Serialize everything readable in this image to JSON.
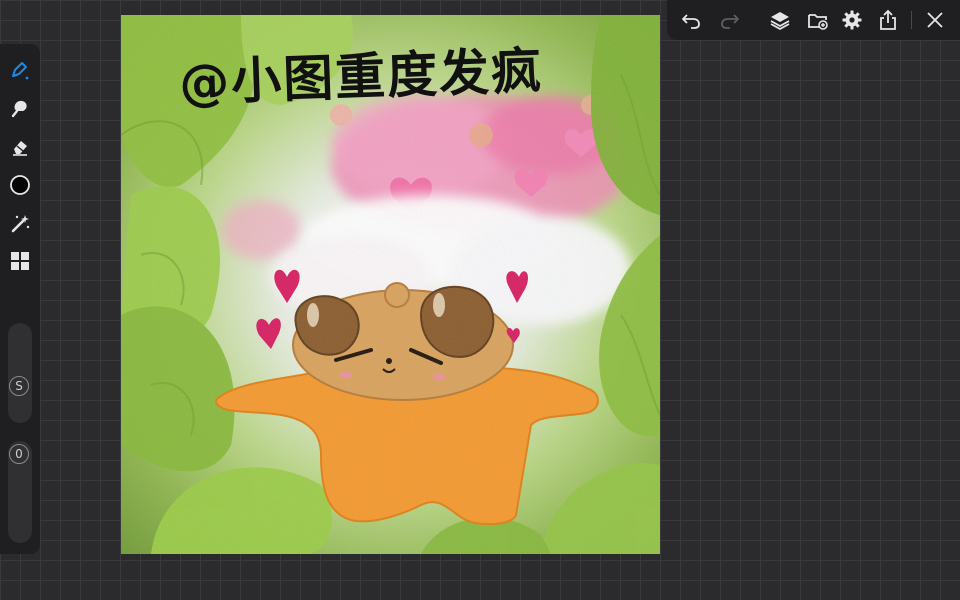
{
  "left_toolbar": {
    "tools": [
      {
        "name": "pen-tool-icon",
        "active": true
      },
      {
        "name": "smudge-tool-icon"
      },
      {
        "name": "eraser-tool-icon"
      },
      {
        "name": "color-picker-icon"
      },
      {
        "name": "magic-wand-icon"
      },
      {
        "name": "gallery-grid-icon"
      }
    ],
    "size_slider": {
      "label": "S"
    },
    "opacity_slider": {
      "label": "0"
    }
  },
  "top_toolbar": {
    "buttons": [
      "undo-icon",
      "redo-icon",
      "layers-icon",
      "import-icon",
      "settings-icon",
      "share-icon",
      "close-icon"
    ]
  },
  "canvas": {
    "handwritten_title": "@小图重度发疯"
  },
  "colors": {
    "accent": "#1e88e5",
    "toolbar_bg": "#1f1f21",
    "workspace_bg": "#2b2b2d"
  }
}
